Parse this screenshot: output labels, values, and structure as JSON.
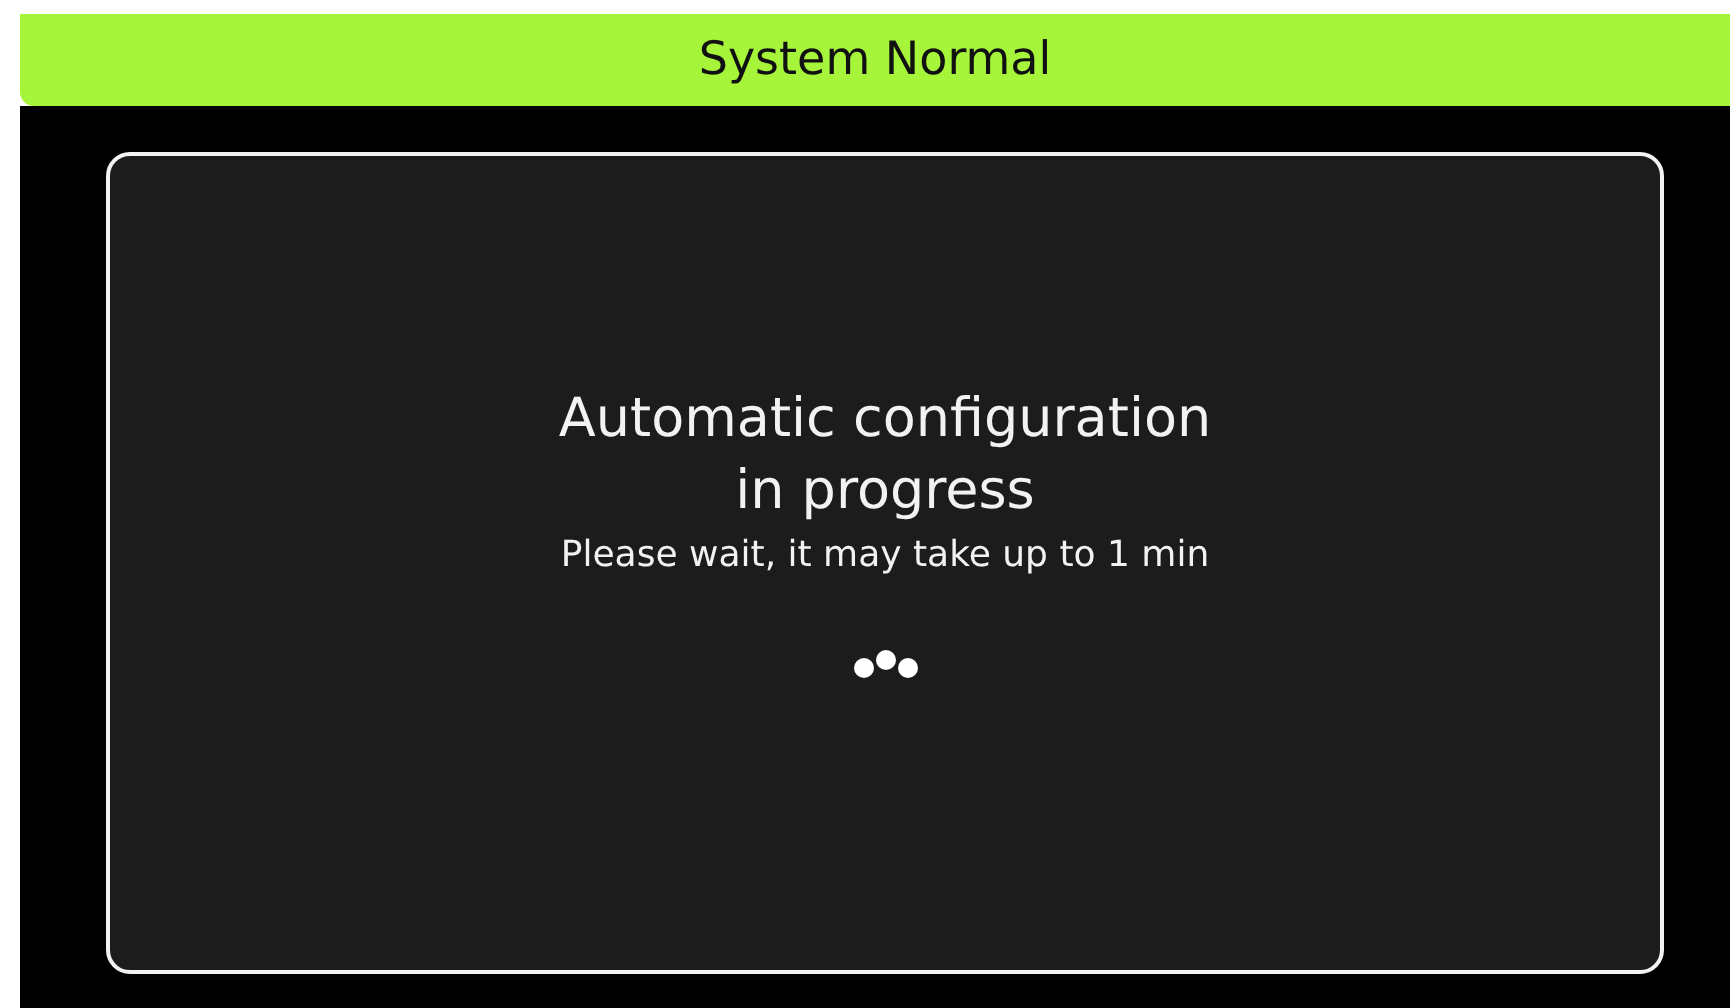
{
  "status_bar": {
    "text": "System Normal",
    "alarm": false
  },
  "dialog": {
    "title_lines": [
      "Automatic configuration",
      "in progress"
    ],
    "message": "Please wait, it may take up to 1 min",
    "busy": true
  }
}
